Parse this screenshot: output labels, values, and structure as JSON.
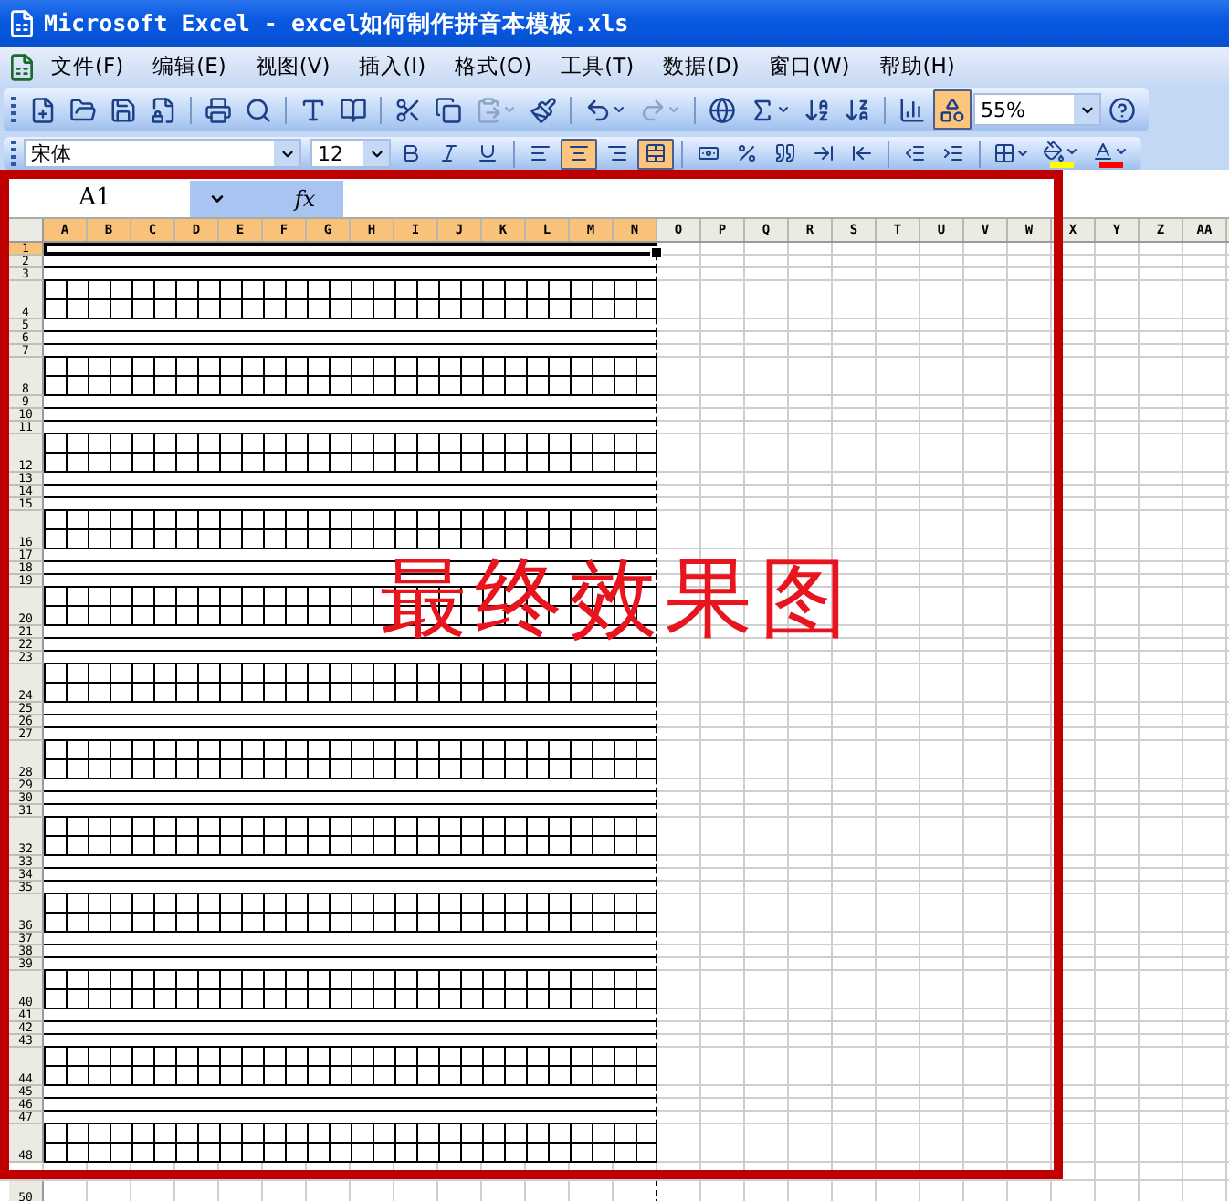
{
  "window": {
    "title": "Microsoft Excel - excel如何制作拼音本模板.xls"
  },
  "menu": [
    {
      "label": "文件(F)"
    },
    {
      "label": "编辑(E)"
    },
    {
      "label": "视图(V)"
    },
    {
      "label": "插入(I)"
    },
    {
      "label": "格式(O)"
    },
    {
      "label": "工具(T)"
    },
    {
      "label": "数据(D)"
    },
    {
      "label": "窗口(W)"
    },
    {
      "label": "帮助(H)"
    }
  ],
  "standard_toolbar": {
    "buttons": [
      {
        "kind": "new",
        "selected": false,
        "dropdown": false,
        "disabled": false
      },
      {
        "kind": "open",
        "selected": false,
        "dropdown": false,
        "disabled": false
      },
      {
        "kind": "save",
        "selected": false,
        "dropdown": false,
        "disabled": false
      },
      {
        "kind": "permission",
        "selected": false,
        "dropdown": false,
        "disabled": false
      },
      {
        "kind": "separator"
      },
      {
        "kind": "print",
        "selected": false,
        "dropdown": false,
        "disabled": false
      },
      {
        "kind": "preview",
        "selected": false,
        "dropdown": false,
        "disabled": false
      },
      {
        "kind": "separator"
      },
      {
        "kind": "spelling",
        "selected": false,
        "dropdown": false,
        "disabled": false
      },
      {
        "kind": "research",
        "selected": false,
        "dropdown": false,
        "disabled": false
      },
      {
        "kind": "separator"
      },
      {
        "kind": "cut",
        "selected": false,
        "dropdown": false,
        "disabled": false
      },
      {
        "kind": "copy",
        "selected": false,
        "dropdown": false,
        "disabled": false
      },
      {
        "kind": "paste",
        "selected": false,
        "dropdown": true,
        "disabled": true
      },
      {
        "kind": "format-painter",
        "selected": false,
        "dropdown": false,
        "disabled": false
      },
      {
        "kind": "separator"
      },
      {
        "kind": "undo",
        "selected": false,
        "dropdown": true,
        "disabled": false
      },
      {
        "kind": "redo",
        "selected": false,
        "dropdown": true,
        "disabled": true
      },
      {
        "kind": "separator"
      },
      {
        "kind": "hyperlink",
        "selected": false,
        "dropdown": false,
        "disabled": false
      },
      {
        "kind": "autosum",
        "selected": false,
        "dropdown": true,
        "disabled": false
      },
      {
        "kind": "sort-ascending",
        "selected": false,
        "dropdown": false,
        "disabled": false
      },
      {
        "kind": "sort-descending",
        "selected": false,
        "dropdown": false,
        "disabled": false
      },
      {
        "kind": "separator"
      },
      {
        "kind": "chart",
        "selected": false,
        "dropdown": false,
        "disabled": false
      },
      {
        "kind": "drawing",
        "selected": true,
        "dropdown": false,
        "disabled": false
      }
    ],
    "zoom": "55%"
  },
  "formatting_toolbar": {
    "font": "宋体",
    "size": "12",
    "buttons": [
      {
        "kind": "bold",
        "selected": false,
        "dropdown": false
      },
      {
        "kind": "italic",
        "selected": false,
        "dropdown": false
      },
      {
        "kind": "underline",
        "selected": false,
        "dropdown": false
      },
      {
        "kind": "separator"
      },
      {
        "kind": "align-left",
        "selected": false,
        "dropdown": false
      },
      {
        "kind": "align-center",
        "selected": true,
        "dropdown": false
      },
      {
        "kind": "align-right",
        "selected": false,
        "dropdown": false
      },
      {
        "kind": "merge",
        "selected": true,
        "dropdown": false
      },
      {
        "kind": "separator"
      },
      {
        "kind": "currency",
        "selected": false,
        "dropdown": false
      },
      {
        "kind": "percent",
        "selected": false,
        "dropdown": false
      },
      {
        "kind": "comma",
        "selected": false,
        "dropdown": false
      },
      {
        "kind": "increase-decimal",
        "selected": false,
        "dropdown": false
      },
      {
        "kind": "decrease-decimal",
        "selected": false,
        "dropdown": false
      },
      {
        "kind": "separator"
      },
      {
        "kind": "outdent",
        "selected": false,
        "dropdown": false
      },
      {
        "kind": "indent",
        "selected": false,
        "dropdown": false
      },
      {
        "kind": "separator"
      },
      {
        "kind": "borders",
        "selected": false,
        "dropdown": true
      },
      {
        "kind": "fill-color",
        "selected": false,
        "dropdown": true,
        "color": "#ffff00"
      },
      {
        "kind": "font-color",
        "selected": false,
        "dropdown": true,
        "color": "#ff0000"
      }
    ]
  },
  "formula_bar": {
    "name_box": "A1",
    "fx": "fx"
  },
  "sheet": {
    "columns": [
      {
        "label": "A",
        "kind": "template",
        "selected": true
      },
      {
        "label": "B",
        "kind": "template",
        "selected": true
      },
      {
        "label": "C",
        "kind": "template",
        "selected": true
      },
      {
        "label": "D",
        "kind": "template",
        "selected": true
      },
      {
        "label": "E",
        "kind": "template",
        "selected": true
      },
      {
        "label": "F",
        "kind": "template",
        "selected": true
      },
      {
        "label": "G",
        "kind": "template",
        "selected": true
      },
      {
        "label": "H",
        "kind": "template",
        "selected": true
      },
      {
        "label": "I",
        "kind": "template",
        "selected": true
      },
      {
        "label": "J",
        "kind": "template",
        "selected": true
      },
      {
        "label": "K",
        "kind": "template",
        "selected": true
      },
      {
        "label": "L",
        "kind": "template",
        "selected": true
      },
      {
        "label": "M",
        "kind": "template",
        "selected": true
      },
      {
        "label": "N",
        "kind": "template",
        "selected": true
      },
      {
        "label": "O",
        "kind": "plain",
        "selected": false
      },
      {
        "label": "P",
        "kind": "plain",
        "selected": false
      },
      {
        "label": "Q",
        "kind": "plain",
        "selected": false
      },
      {
        "label": "R",
        "kind": "plain",
        "selected": false
      },
      {
        "label": "S",
        "kind": "plain",
        "selected": false
      },
      {
        "label": "T",
        "kind": "plain",
        "selected": false
      },
      {
        "label": "U",
        "kind": "plain",
        "selected": false
      },
      {
        "label": "V",
        "kind": "plain",
        "selected": false
      },
      {
        "label": "W",
        "kind": "plain",
        "selected": false
      },
      {
        "label": "X",
        "kind": "plain",
        "selected": false
      },
      {
        "label": "Y",
        "kind": "plain",
        "selected": false
      },
      {
        "label": "Z",
        "kind": "plain",
        "selected": false
      },
      {
        "label": "AA",
        "kind": "plain",
        "selected": false
      }
    ],
    "rows": [
      {
        "label": "1",
        "kind": "line",
        "selected": true
      },
      {
        "label": "2",
        "kind": "line",
        "selected": false
      },
      {
        "label": "3",
        "kind": "line",
        "selected": false
      },
      {
        "label": "4",
        "kind": "grid",
        "selected": false
      },
      {
        "label": "5",
        "kind": "line",
        "selected": false
      },
      {
        "label": "6",
        "kind": "line",
        "selected": false
      },
      {
        "label": "7",
        "kind": "line",
        "selected": false
      },
      {
        "label": "8",
        "kind": "grid",
        "selected": false
      },
      {
        "label": "9",
        "kind": "line",
        "selected": false
      },
      {
        "label": "10",
        "kind": "line",
        "selected": false
      },
      {
        "label": "11",
        "kind": "line",
        "selected": false
      },
      {
        "label": "12",
        "kind": "grid",
        "selected": false
      },
      {
        "label": "13",
        "kind": "line",
        "selected": false
      },
      {
        "label": "14",
        "kind": "line",
        "selected": false
      },
      {
        "label": "15",
        "kind": "line",
        "selected": false
      },
      {
        "label": "16",
        "kind": "grid",
        "selected": false
      },
      {
        "label": "17",
        "kind": "line",
        "selected": false
      },
      {
        "label": "18",
        "kind": "line",
        "selected": false
      },
      {
        "label": "19",
        "kind": "line",
        "selected": false
      },
      {
        "label": "20",
        "kind": "grid",
        "selected": false
      },
      {
        "label": "21",
        "kind": "line",
        "selected": false
      },
      {
        "label": "22",
        "kind": "line",
        "selected": false
      },
      {
        "label": "23",
        "kind": "line",
        "selected": false
      },
      {
        "label": "24",
        "kind": "grid",
        "selected": false
      },
      {
        "label": "25",
        "kind": "line",
        "selected": false
      },
      {
        "label": "26",
        "kind": "line",
        "selected": false
      },
      {
        "label": "27",
        "kind": "line",
        "selected": false
      },
      {
        "label": "28",
        "kind": "grid",
        "selected": false
      },
      {
        "label": "29",
        "kind": "line",
        "selected": false
      },
      {
        "label": "30",
        "kind": "line",
        "selected": false
      },
      {
        "label": "31",
        "kind": "line",
        "selected": false
      },
      {
        "label": "32",
        "kind": "grid",
        "selected": false
      },
      {
        "label": "33",
        "kind": "line",
        "selected": false
      },
      {
        "label": "34",
        "kind": "line",
        "selected": false
      },
      {
        "label": "35",
        "kind": "line",
        "selected": false
      },
      {
        "label": "36",
        "kind": "grid",
        "selected": false
      },
      {
        "label": "37",
        "kind": "line",
        "selected": false
      },
      {
        "label": "38",
        "kind": "line",
        "selected": false
      },
      {
        "label": "39",
        "kind": "line",
        "selected": false
      },
      {
        "label": "40",
        "kind": "grid",
        "selected": false
      },
      {
        "label": "41",
        "kind": "line",
        "selected": false
      },
      {
        "label": "42",
        "kind": "line",
        "selected": false
      },
      {
        "label": "43",
        "kind": "line",
        "selected": false
      },
      {
        "label": "44",
        "kind": "grid",
        "selected": false
      },
      {
        "label": "45",
        "kind": "line",
        "selected": false
      },
      {
        "label": "46",
        "kind": "line",
        "selected": false
      },
      {
        "label": "47",
        "kind": "line",
        "selected": false
      },
      {
        "label": "48",
        "kind": "grid",
        "selected": false
      },
      {
        "label": "50",
        "kind": "plain",
        "selected": false
      }
    ]
  },
  "annotation": {
    "text": "最终效果图"
  }
}
